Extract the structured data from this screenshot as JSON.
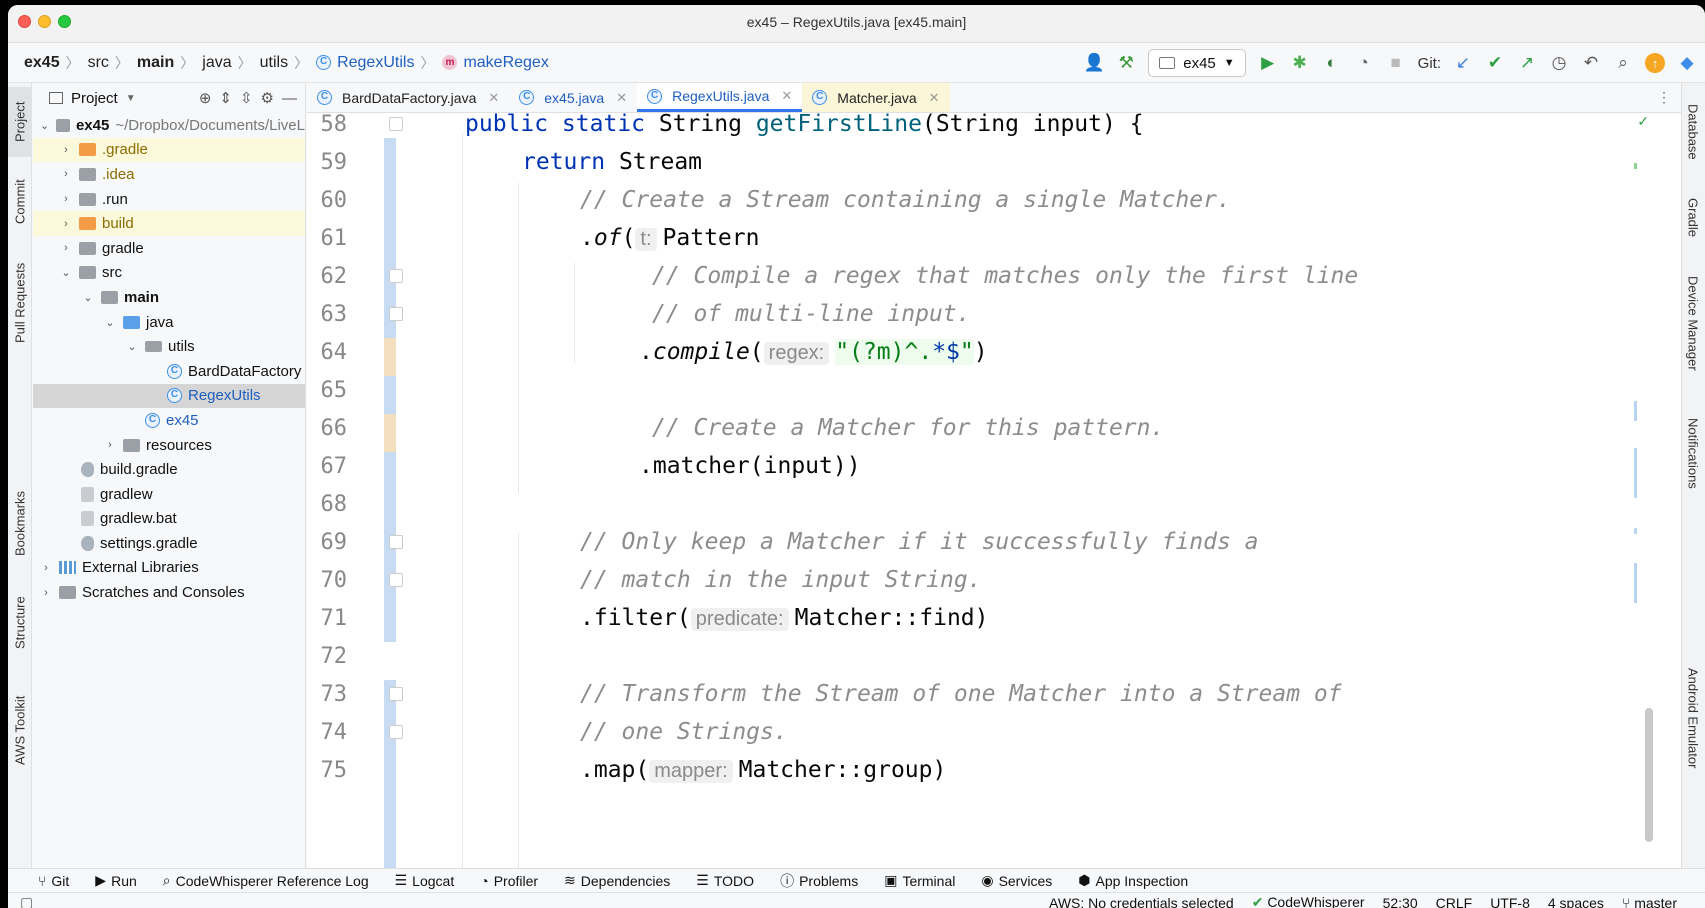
{
  "window": {
    "title": "ex45 – RegexUtils.java [ex45.main]"
  },
  "breadcrumb": [
    "ex45",
    "src",
    "main",
    "java",
    "utils",
    "RegexUtils",
    "makeRegex"
  ],
  "toolbar": {
    "run_config": "ex45",
    "git_label": "Git:"
  },
  "left_tabs": [
    "Project",
    "Commit",
    "Pull Requests",
    "Bookmarks",
    "Structure",
    "AWS Toolkit"
  ],
  "right_tabs": [
    "Database",
    "Gradle",
    "Device Manager",
    "Notifications",
    "Android Emulator"
  ],
  "project": {
    "header": "Project",
    "root_name": "ex45",
    "root_path": "~/Dropbox/Documents/LiveL",
    "items": [
      {
        "label": ".gradle"
      },
      {
        "label": ".idea"
      },
      {
        "label": ".run"
      },
      {
        "label": "build"
      },
      {
        "label": "gradle"
      },
      {
        "label": "src"
      },
      {
        "label": "main"
      },
      {
        "label": "java"
      },
      {
        "label": "utils"
      },
      {
        "label": "BardDataFactory"
      },
      {
        "label": "RegexUtils"
      },
      {
        "label": "ex45"
      },
      {
        "label": "resources"
      },
      {
        "label": "build.gradle"
      },
      {
        "label": "gradlew"
      },
      {
        "label": "gradlew.bat"
      },
      {
        "label": "settings.gradle"
      },
      {
        "label": "External Libraries"
      },
      {
        "label": "Scratches and Consoles"
      }
    ]
  },
  "tabs": [
    "BardDataFactory.java",
    "ex45.java",
    "RegexUtils.java",
    "Matcher.java"
  ],
  "code": {
    "line_numbers": [
      "58",
      "59",
      "60",
      "61",
      "62",
      "63",
      "64",
      "65",
      "66",
      "67",
      "68",
      "69",
      "70",
      "71",
      "72",
      "73",
      "74",
      "75"
    ],
    "l58_a": "public static ",
    "l58_b": "String ",
    "l58_c": "getFirstLine",
    "l58_d": "(String input) {",
    "l59_a": "return ",
    "l59_b": "Stream",
    "l60": "// Create a Stream containing a single Matcher.",
    "l61_a": ".",
    "l61_b": "of",
    "l61_c": "(",
    "l61_hint": "t:",
    "l61_d": "Pattern",
    "l62": "// Compile a regex that matches only the first line",
    "l63": "// of multi-line input.",
    "l64_a": ".",
    "l64_b": "compile",
    "l64_c": "(",
    "l64_hint": "regex:",
    "l64_q1": "\"",
    "l64_r1": "(?m)^.",
    "l64_r2": "*$",
    "l64_q2": "\"",
    "l64_d": ")",
    "l66": "// Create a Matcher for this pattern.",
    "l67": ".matcher(input))",
    "l69": "// Only keep a Matcher if it successfully finds a",
    "l70": "// match in the input String.",
    "l71_a": ".filter(",
    "l71_hint": "predicate:",
    "l71_b": "Matcher::find)",
    "l73": "// Transform the Stream of one Matcher into a Stream of",
    "l74": "// one Strings.",
    "l75_a": ".map(",
    "l75_hint": "mapper:",
    "l75_b": "Matcher::group)"
  },
  "tool_windows": [
    "Git",
    "Run",
    "CodeWhisperer Reference Log",
    "Logcat",
    "Profiler",
    "Dependencies",
    "TODO",
    "Problems",
    "Terminal",
    "Services",
    "App Inspection"
  ],
  "status": {
    "aws": "AWS: No credentials selected",
    "codewhisperer": "CodeWhisperer",
    "position": "52:30",
    "line_sep": "CRLF",
    "encoding": "UTF-8",
    "indent": "4 spaces",
    "branch": "master"
  }
}
